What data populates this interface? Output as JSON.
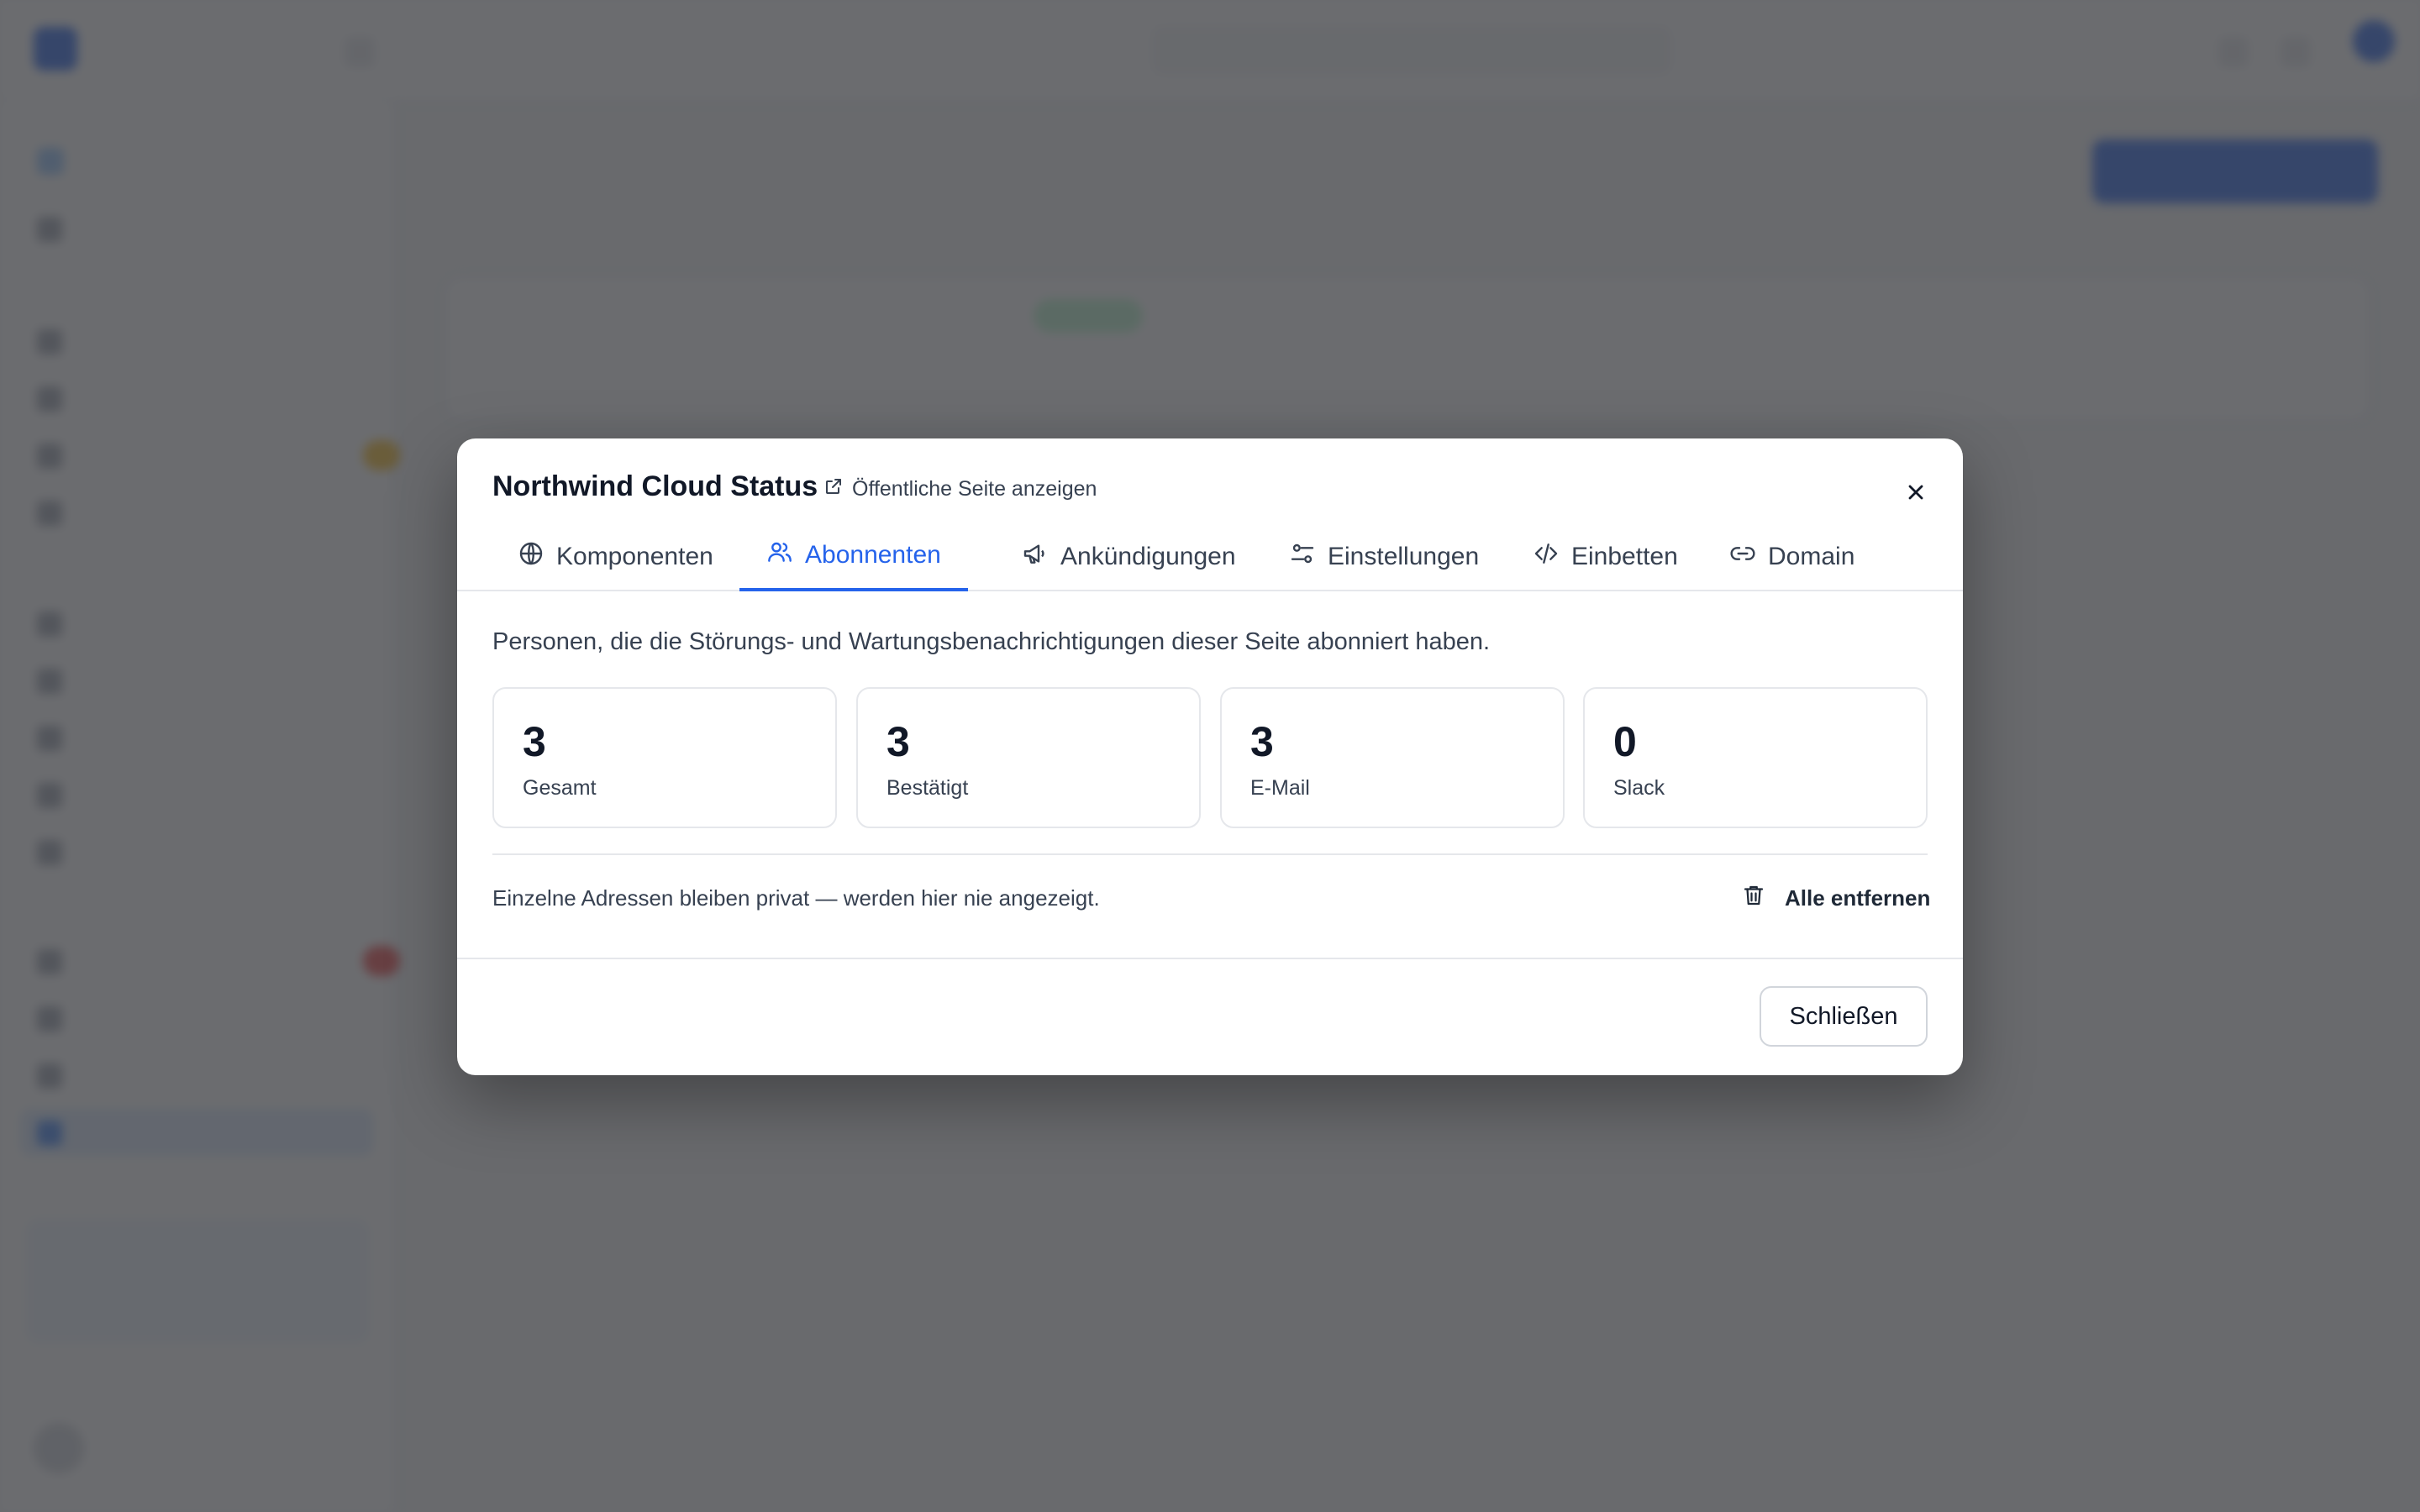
{
  "modal": {
    "title": "Northwind Cloud Status",
    "public_link_label": "Öffentliche Seite anzeigen",
    "tabs": [
      {
        "label": "Komponenten",
        "icon": "globe-icon",
        "active": false
      },
      {
        "label": "Abonnenten",
        "icon": "users-icon",
        "active": true
      },
      {
        "label": "Ankündigungen",
        "icon": "megaphone-icon",
        "active": false
      },
      {
        "label": "Einstellungen",
        "icon": "sliders-icon",
        "active": false
      },
      {
        "label": "Einbetten",
        "icon": "code-icon",
        "active": false
      },
      {
        "label": "Domain",
        "icon": "link-icon",
        "active": false
      }
    ],
    "description": "Personen, die die Störungs- und Wartungsbenachrichtigungen dieser Seite abonniert haben.",
    "stats": [
      {
        "value": "3",
        "label": "Gesamt"
      },
      {
        "value": "3",
        "label": "Bestätigt"
      },
      {
        "value": "3",
        "label": "E-Mail"
      },
      {
        "value": "0",
        "label": "Slack"
      }
    ],
    "privacy_note": "Einzelne Adressen bleiben privat — werden hier nie angezeigt.",
    "remove_all_label": "Alle entfernen",
    "close_label": "Schließen"
  },
  "colors": {
    "accent": "#2563eb",
    "overlay": "#3c3e42",
    "text": "#111827",
    "muted": "#374151",
    "border": "#e5e7eb"
  }
}
